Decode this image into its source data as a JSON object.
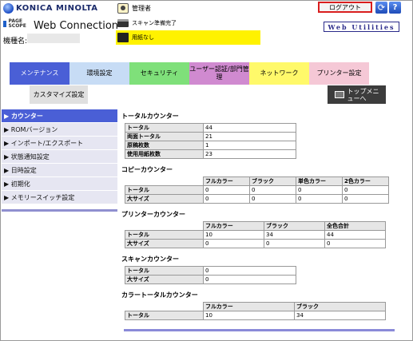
{
  "header": {
    "brand": "KONICA MINOLTA",
    "pagescope": "PAGE SCOPE",
    "web_connection": "Web Connection",
    "device_label": "機種名:",
    "admin_label": "管理者",
    "scan_status": "スキャン準備完了",
    "paper_status": "用紙なし",
    "logout_label": "ログアウト",
    "refresh_glyph": "⟳",
    "help_glyph": "?",
    "web_utilities": "Web Utilities"
  },
  "tabs": [
    {
      "label": "メンテナンス",
      "color": "#4a5fd6"
    },
    {
      "label": "環境設定",
      "color": "#c7dcf5"
    },
    {
      "label": "セキュリティ",
      "color": "#7fe07a"
    },
    {
      "label": "ユーザー認証/部門管理",
      "color": "#d08ad0"
    },
    {
      "label": "ネットワーク",
      "color": "#fff96a"
    },
    {
      "label": "プリンター設定",
      "color": "#f5c8d6"
    }
  ],
  "subtab": "カスタマイズ設定",
  "top_menu": "トップメニューへ",
  "sidebar": [
    {
      "label": "▶ カウンター"
    },
    {
      "label": "▶ ROMバージョン"
    },
    {
      "label": "▶ インポート/エクスポート"
    },
    {
      "label": "▶ 状態通知設定"
    },
    {
      "label": "▶ 日時設定"
    },
    {
      "label": "▶ 初期化"
    },
    {
      "label": "▶ メモリースイッチ設定"
    }
  ],
  "total": {
    "title": "トータルカウンター",
    "rows": [
      [
        "トータル",
        "44"
      ],
      [
        "両面トータル",
        "21"
      ],
      [
        "原稿枚数",
        "1"
      ],
      [
        "使用用紙枚数",
        "23"
      ]
    ]
  },
  "copy": {
    "title": "コピーカウンター",
    "header": [
      "",
      "フルカラー",
      "ブラック",
      "単色カラー",
      "2色カラー"
    ],
    "rows": [
      [
        "トータル",
        "0",
        "0",
        "0",
        "0"
      ],
      [
        "大サイズ",
        "0",
        "0",
        "0",
        "0"
      ]
    ]
  },
  "printer": {
    "title": "プリンターカウンター",
    "header": [
      "",
      "フルカラー",
      "ブラック",
      "全色合計"
    ],
    "rows": [
      [
        "トータル",
        "10",
        "34",
        "44"
      ],
      [
        "大サイズ",
        "0",
        "0",
        "0"
      ]
    ]
  },
  "scan": {
    "title": "スキャンカウンター",
    "rows": [
      [
        "トータル",
        "0"
      ],
      [
        "大サイズ",
        "0"
      ]
    ]
  },
  "color_total": {
    "title": "カラートータルカウンター",
    "header": [
      "",
      "フルカラー",
      "ブラック"
    ],
    "rows": [
      [
        "トータル",
        "10",
        "34"
      ]
    ]
  }
}
